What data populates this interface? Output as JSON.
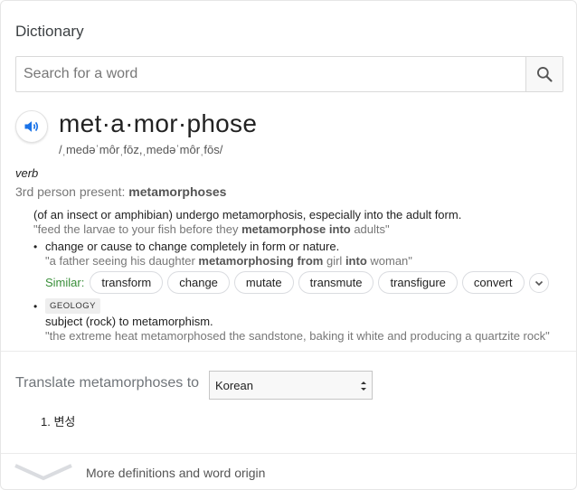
{
  "header": {
    "title": "Dictionary"
  },
  "search": {
    "placeholder": "Search for a word",
    "button_icon": "search-icon"
  },
  "entry": {
    "speaker_icon": "speaker-icon",
    "word": "met·a·mor·phose",
    "phonetic": "/ˌmedəˈmôrˌfōz,ˌmedəˈmôrˌfōs/",
    "part_of_speech": "verb",
    "forms_label": "3rd person present: ",
    "forms_value": "metamorphoses"
  },
  "senses": [
    {
      "definition": "(of an insect or amphibian) undergo metamorphosis, especially into the adult form.",
      "example_parts": [
        "\"feed the larvae to your fish before they ",
        "metamorphose into",
        " adults\""
      ]
    },
    {
      "definition": "change or cause to change completely in form or nature.",
      "example_parts": [
        "\"a father seeing his daughter ",
        "metamorphosing from",
        " girl ",
        "into",
        " woman\""
      ],
      "similar_label": "Similar:",
      "similar": [
        "transform",
        "change",
        "mutate",
        "transmute",
        "transfigure",
        "convert"
      ]
    },
    {
      "tag": "GEOLOGY",
      "definition": "subject (rock) to metamorphism.",
      "example": "\"the extreme heat metamorphosed the sandstone, baking it white and producing a quartzite rock\""
    }
  ],
  "translate": {
    "label": "Translate metamorphoses to",
    "selected_language": "Korean",
    "results": [
      "1. 변성"
    ]
  },
  "footer": {
    "more_label": "More definitions and word origin"
  },
  "colors": {
    "speaker_blue": "#1a73e8",
    "similar_green": "#3a8f3a"
  }
}
